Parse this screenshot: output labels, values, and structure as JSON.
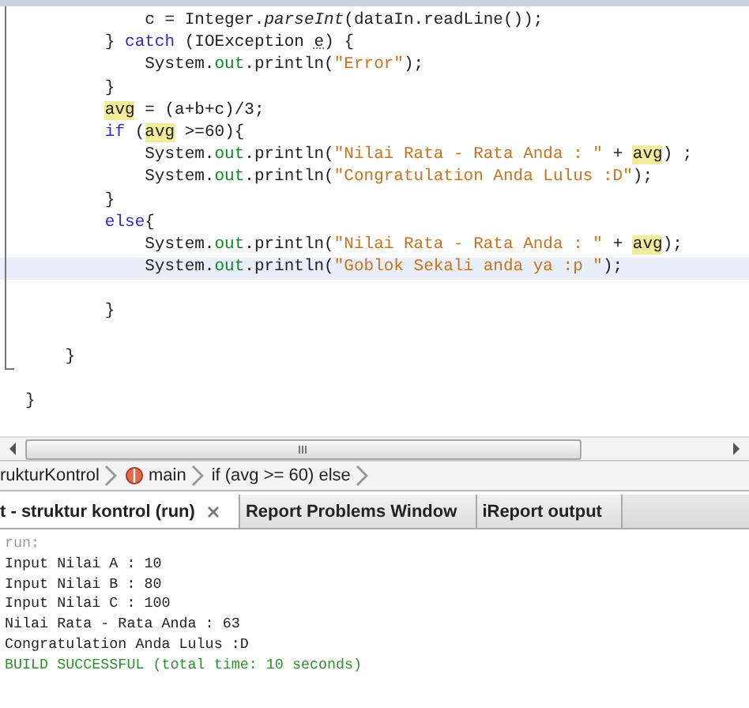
{
  "editor": {
    "lines": [
      {
        "kind": "code",
        "current": false,
        "tokens": [
          {
            "text": "            c = Integer.",
            "kind": "plain"
          },
          {
            "text": "parseInt",
            "kind": "method"
          },
          {
            "text": "(dataIn.readLine());",
            "kind": "plain"
          }
        ]
      },
      {
        "kind": "code",
        "current": false,
        "tokens": [
          {
            "text": "        } ",
            "kind": "plain"
          },
          {
            "text": "catch",
            "kind": "keyword"
          },
          {
            "text": " (IOException ",
            "kind": "plain"
          },
          {
            "text": "e",
            "kind": "unused"
          },
          {
            "text": ") {",
            "kind": "plain"
          }
        ]
      },
      {
        "kind": "code",
        "current": false,
        "tokens": [
          {
            "text": "            System.",
            "kind": "plain"
          },
          {
            "text": "out",
            "kind": "field"
          },
          {
            "text": ".println(",
            "kind": "plain"
          },
          {
            "text": "\"Error\"",
            "kind": "string"
          },
          {
            "text": ");",
            "kind": "plain"
          }
        ]
      },
      {
        "kind": "code",
        "current": false,
        "tokens": [
          {
            "text": "        }",
            "kind": "plain"
          }
        ]
      },
      {
        "kind": "code",
        "current": false,
        "tokens": [
          {
            "text": "        avg",
            "kind": "occurrence"
          },
          {
            "text": " = (a+b+c)/3;",
            "kind": "plain"
          }
        ]
      },
      {
        "kind": "code",
        "current": false,
        "tokens": [
          {
            "text": "        if",
            "kind": "keyword"
          },
          {
            "text": " (",
            "kind": "plain"
          },
          {
            "text": "avg",
            "kind": "occurrence"
          },
          {
            "text": " >=60){",
            "kind": "plain"
          }
        ]
      },
      {
        "kind": "code",
        "current": false,
        "tokens": [
          {
            "text": "            System.",
            "kind": "plain"
          },
          {
            "text": "out",
            "kind": "field"
          },
          {
            "text": ".println(",
            "kind": "plain"
          },
          {
            "text": "\"Nilai Rata - Rata Anda : \"",
            "kind": "string"
          },
          {
            "text": " + ",
            "kind": "plain"
          },
          {
            "text": "avg",
            "kind": "occurrence"
          },
          {
            "text": ") ;",
            "kind": "plain"
          }
        ]
      },
      {
        "kind": "code",
        "current": false,
        "tokens": [
          {
            "text": "            System.",
            "kind": "plain"
          },
          {
            "text": "out",
            "kind": "field"
          },
          {
            "text": ".println(",
            "kind": "plain"
          },
          {
            "text": "\"Congratulation Anda Lulus :D\"",
            "kind": "string"
          },
          {
            "text": ");",
            "kind": "plain"
          }
        ]
      },
      {
        "kind": "code",
        "current": false,
        "tokens": [
          {
            "text": "        }",
            "kind": "plain"
          }
        ]
      },
      {
        "kind": "code",
        "current": false,
        "tokens": [
          {
            "text": "        else",
            "kind": "keyword"
          },
          {
            "text": "{",
            "kind": "plain"
          }
        ]
      },
      {
        "kind": "code",
        "current": false,
        "tokens": [
          {
            "text": "            System.",
            "kind": "plain"
          },
          {
            "text": "out",
            "kind": "field"
          },
          {
            "text": ".println(",
            "kind": "plain"
          },
          {
            "text": "\"Nilai Rata - Rata Anda : \"",
            "kind": "string"
          },
          {
            "text": " + ",
            "kind": "plain"
          },
          {
            "text": "avg",
            "kind": "occurrence"
          },
          {
            "text": ");",
            "kind": "plain"
          }
        ]
      },
      {
        "kind": "code",
        "current": true,
        "tokens": [
          {
            "text": "            System.",
            "kind": "plain"
          },
          {
            "text": "out",
            "kind": "field"
          },
          {
            "text": ".println(",
            "kind": "plain"
          },
          {
            "text": "\"Goblok Sekali anda ya :p \"",
            "kind": "string"
          },
          {
            "text": ");",
            "kind": "plain"
          }
        ]
      },
      {
        "kind": "blank",
        "current": false
      },
      {
        "kind": "code",
        "current": false,
        "tokens": [
          {
            "text": "        }",
            "kind": "plain"
          }
        ]
      },
      {
        "kind": "blank",
        "current": false
      },
      {
        "kind": "code",
        "current": false,
        "tokens": [
          {
            "text": "    }",
            "kind": "plain"
          }
        ]
      },
      {
        "kind": "blank",
        "current": false
      },
      {
        "kind": "code",
        "current": false,
        "tokens": [
          {
            "text": "}",
            "kind": "plain"
          }
        ]
      }
    ]
  },
  "breadcrumbs": [
    {
      "label": "rukturKontrol",
      "kind": "class"
    },
    {
      "label": "main",
      "kind": "method"
    },
    {
      "label": "if (avg >= 60) else",
      "kind": "plain"
    }
  ],
  "output_tabs": [
    {
      "label": "t - struktur kontrol (run)",
      "selected": true,
      "closable": true
    },
    {
      "label": "Report Problems Window",
      "selected": false,
      "closable": false
    },
    {
      "label": "iReport output",
      "selected": false,
      "closable": false
    }
  ],
  "output": [
    {
      "text": "run:",
      "kind": "muted"
    },
    {
      "text": "Input Nilai A : 10",
      "kind": "normal"
    },
    {
      "text": "Input Nilai B : 80",
      "kind": "normal"
    },
    {
      "text": "Input Nilai C : 100",
      "kind": "normal"
    },
    {
      "text": "Nilai Rata - Rata Anda : 63",
      "kind": "normal"
    },
    {
      "text": "Congratulation Anda Lulus :D",
      "kind": "normal"
    },
    {
      "text": "BUILD SUCCESSFUL (total time: 10 seconds)",
      "kind": "success"
    }
  ]
}
